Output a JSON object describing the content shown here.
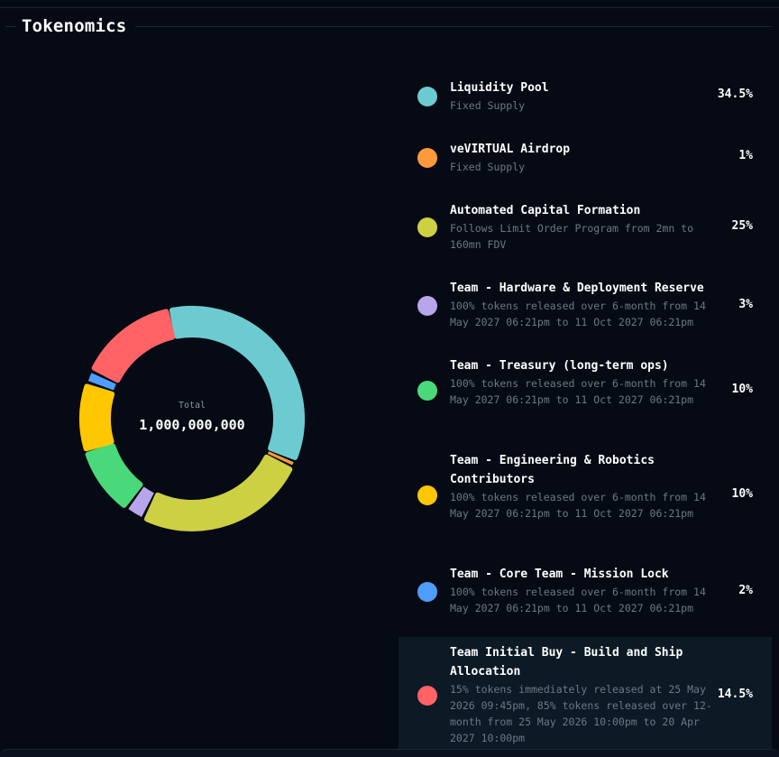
{
  "header": {
    "title": "Tokenomics"
  },
  "center": {
    "label": "Total",
    "value": "1,000,000,000"
  },
  "chart_data": {
    "type": "pie",
    "categories": [
      "Liquidity Pool",
      "veVIRTUAL Airdrop",
      "Automated Capital Formation",
      "Team - Hardware & Deployment Reserve",
      "Team - Treasury (long-term ops)",
      "Team - Engineering & Robotics Contributors",
      "Team - Core Team - Mission Lock",
      "Team Initial Buy - Build and Ship Allocation"
    ],
    "values": [
      34.5,
      1,
      25,
      3,
      10,
      10,
      2,
      14.5
    ],
    "colors": [
      "#6ccbd0",
      "#ff9a3c",
      "#cdd042",
      "#b7a6ec",
      "#4ad97a",
      "#ffc700",
      "#4e9dff",
      "#ff6366"
    ]
  },
  "legend": [
    {
      "name": "Liquidity Pool",
      "desc": "Fixed Supply",
      "pct": "34.5%",
      "color": "#6ccbd0"
    },
    {
      "name": "veVIRTUAL Airdrop",
      "desc": "Fixed Supply",
      "pct": "1%",
      "color": "#ff9a3c"
    },
    {
      "name": "Automated Capital Formation",
      "desc": "Follows Limit Order Program from 2mn to 160mn FDV",
      "pct": "25%",
      "color": "#cdd042"
    },
    {
      "name": "Team - Hardware & Deployment Reserve",
      "desc": "100% tokens released over 6-month from 14 May 2027 06:21pm to 11 Oct 2027 06:21pm",
      "pct": "3%",
      "color": "#b7a6ec"
    },
    {
      "name": "Team - Treasury (long-term ops)",
      "desc": "100% tokens released over 6-month from 14 May 2027 06:21pm to 11 Oct 2027 06:21pm",
      "pct": "10%",
      "color": "#4ad97a"
    },
    {
      "name": "Team - Engineering & Robotics Contributors",
      "desc": "100% tokens released over 6-month from 14 May 2027 06:21pm to 11 Oct 2027 06:21pm",
      "pct": "10%",
      "color": "#ffc700"
    },
    {
      "name": "Team - Core Team - Mission Lock",
      "desc": "100% tokens released over 6-month from 14 May 2027 06:21pm to 11 Oct 2027 06:21pm",
      "pct": "2%",
      "color": "#4e9dff"
    },
    {
      "name": "Team Initial Buy - Build and Ship Allocation",
      "desc": "15% tokens immediately released at 25 May 2026 09:45pm, 85% tokens released over 12-month from 25 May 2026 10:00pm to 20 Apr 2027 10:00pm",
      "pct": "14.5%",
      "color": "#ff6366",
      "highlighted": true
    }
  ]
}
